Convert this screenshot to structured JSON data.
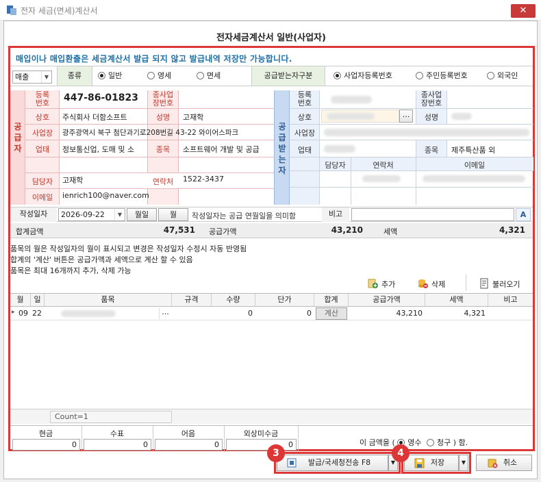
{
  "window": {
    "title": "전자 세금(면세)계산서",
    "close": "✕"
  },
  "form_title": "전자세금계산서 일반(사업자)",
  "notice": "매입이나 매입환출은 세금계산서 발급 되지 않고 발급내역 저장만 가능합니다.",
  "type_row": {
    "direction_value": "매출",
    "kind_label": "종류",
    "kinds": [
      {
        "label": "일반",
        "checked": true
      },
      {
        "label": "영세",
        "checked": false
      },
      {
        "label": "면세",
        "checked": false
      }
    ],
    "receiver_type_label": "공급받는자구분",
    "receiver_types": [
      {
        "label": "사업자등록번호",
        "checked": true
      },
      {
        "label": "주민등록번호",
        "checked": false
      },
      {
        "label": "외국인",
        "checked": false
      }
    ]
  },
  "supplier": {
    "side_label": "공급자",
    "reg_no_label": "등록\n번호",
    "reg_no": "447-86-01823",
    "branch_label": "종사업\n장번호",
    "company_label": "상호",
    "company": "주식회사 더함소프트",
    "ceo_label": "성명",
    "ceo": "고재학",
    "address_label": "사업장",
    "address": "광주광역시 북구 첨단과기로208번길 43-22 와이어스파크",
    "business_label": "업태",
    "business": "정보통신업, 도매 및 소",
    "item_label": "종목",
    "item": "소프트웨어 개발 및 공급",
    "manager_label": "담당자",
    "manager": "고재학",
    "phone_label": "연락처",
    "phone": "1522-3437",
    "email_label": "이메일",
    "email": "ienrich100@naver.com"
  },
  "receiver": {
    "side_label": "공급받는자",
    "reg_no_label": "등록\n번호",
    "branch_label": "종사업\n장번호",
    "company_label": "상호",
    "ceo_label": "성명",
    "address_label": "사업장",
    "business_label": "업태",
    "item_label": "종목",
    "item": "제주특산품 외",
    "manager_label": "담당자",
    "phone_label": "연락처",
    "email_label": "이메일",
    "more_button": "..."
  },
  "date_row": {
    "label": "작성일자",
    "date": "2026-09-22",
    "day_btn": "월일",
    "month_btn": "월",
    "hint": "작성일자는 공급 연월일을 의미함",
    "memo_label": "비고",
    "memo_value": ""
  },
  "totals": {
    "sum_label": "합계금액",
    "sum": "47,531",
    "supply_label": "공급가액",
    "supply": "43,210",
    "tax_label": "세액",
    "tax": "4,321"
  },
  "info_lines": [
    "품목의 월은 작성일자의 월이 표시되고 변경은 작성일자 수정시 자동 반영됨",
    "합계의 '계산' 버튼은 공급가액과 세액으로 계산 할 수 있음",
    "품목은 최대 16개까지 추가, 삭제 가능"
  ],
  "toolbar": {
    "add": "추가",
    "delete": "삭제",
    "load": "불러오기"
  },
  "grid": {
    "headers": [
      "월",
      "일",
      "품목",
      "규격",
      "수량",
      "단가",
      "합계",
      "공급가액",
      "세액",
      "비고"
    ],
    "rows": [
      {
        "month": "09",
        "day": "22",
        "item": "",
        "spec": "",
        "qty": "0",
        "price": "0",
        "sum_btn": "계산",
        "supply": "43,210",
        "tax": "4,321",
        "memo": ""
      }
    ],
    "row_marker": "▸",
    "count_text": "Count=1"
  },
  "payment": {
    "labels": [
      "현금",
      "수표",
      "어음",
      "외상미수금"
    ],
    "values": [
      "0",
      "0",
      "0",
      "0"
    ],
    "amount_prefix": "이 금액을 (",
    "receipt": "영수",
    "claim": "청구",
    "amount_suffix": ") 함."
  },
  "buttons": {
    "issue": "발급/국세청전송 F8",
    "save": "저장",
    "cancel": "취소"
  },
  "badges": [
    "3",
    "4"
  ]
}
